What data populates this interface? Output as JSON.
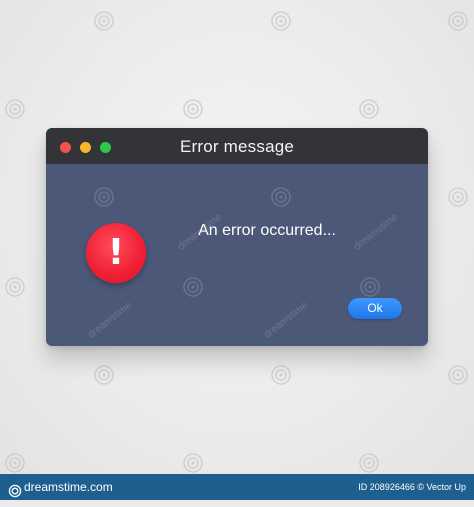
{
  "window": {
    "title": "Error message",
    "message": "An error occurred...",
    "ok_label": "Ok",
    "error_symbol": "!",
    "icon": "error-exclamation-icon"
  },
  "watermark": {
    "text": "dreamstime",
    "icon": "dreamstime-spiral-icon"
  },
  "footer": {
    "brand": "dreamstime.com",
    "image_id": "ID 208926466 © Vector Up"
  },
  "colors": {
    "titlebar": "#333437",
    "content": "#4c5877",
    "traffic_red": "#f0544c",
    "traffic_yellow": "#f7b52c",
    "traffic_green": "#2ec84a",
    "error_red": "#f01e33",
    "ok_blue": "#2b86f5",
    "footer": "#1f5f8f"
  }
}
